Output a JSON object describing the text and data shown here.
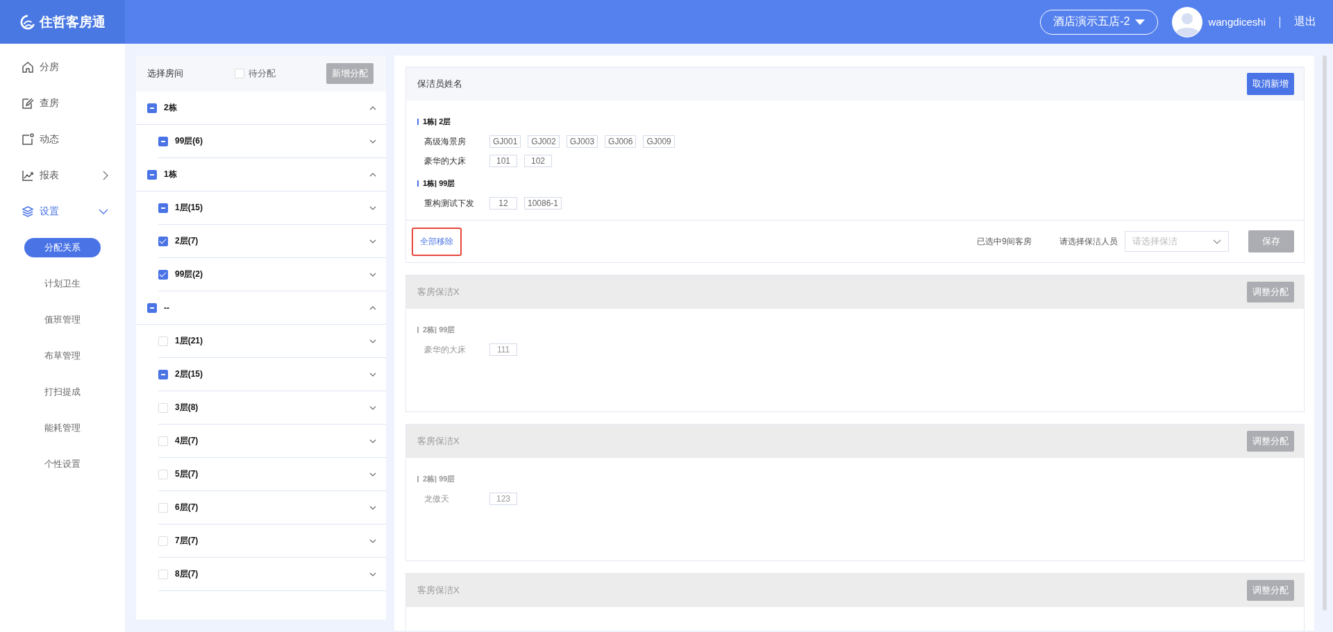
{
  "header": {
    "logo_text": "住哲客房通",
    "store_selector": "酒店演示五店-2",
    "username": "wangdiceshi",
    "logout": "退出"
  },
  "sidebar": {
    "items": [
      {
        "label": "分房",
        "selected": false
      },
      {
        "label": "查房",
        "selected": false
      },
      {
        "label": "动态",
        "selected": false
      },
      {
        "label": "报表",
        "selected": false,
        "expanded": false
      },
      {
        "label": "设置",
        "selected": true,
        "expanded": true,
        "children": [
          {
            "label": "分配关系",
            "selected": true
          },
          {
            "label": "计划卫生",
            "selected": false
          },
          {
            "label": "值班管理",
            "selected": false
          },
          {
            "label": "布草管理",
            "selected": false
          },
          {
            "label": "打扫提成",
            "selected": false
          },
          {
            "label": "能耗管理",
            "selected": false
          },
          {
            "label": "个性设置",
            "selected": false
          }
        ]
      }
    ]
  },
  "room_panel": {
    "title": "选择房间",
    "pending": {
      "label": "待分配",
      "checked": false
    },
    "add_button": {
      "label": "新增分配",
      "disabled": true
    },
    "tree": [
      {
        "label": "2栋",
        "checked": false,
        "indeterminate": true,
        "expanded": true,
        "children": [
          {
            "label": "99层(6)",
            "checked": false,
            "indeterminate": true,
            "expanded": false
          }
        ]
      },
      {
        "label": "1栋",
        "checked": false,
        "indeterminate": true,
        "expanded": true,
        "children": [
          {
            "label": "1层(15)",
            "checked": false,
            "indeterminate": true,
            "expanded": false
          },
          {
            "label": "2层(7)",
            "checked": true,
            "expanded": false
          },
          {
            "label": "99层(2)",
            "checked": true,
            "expanded": false
          }
        ]
      },
      {
        "label": "--",
        "checked": false,
        "indeterminate": true,
        "expanded": true,
        "children": [
          {
            "label": "1层(21)",
            "checked": false,
            "indeterminate": false,
            "expanded": false
          },
          {
            "label": "2层(15)",
            "checked": false,
            "indeterminate": true,
            "expanded": false
          },
          {
            "label": "3层(8)",
            "checked": false,
            "indeterminate": false,
            "expanded": false
          },
          {
            "label": "4层(7)",
            "checked": false,
            "indeterminate": false,
            "expanded": false
          },
          {
            "label": "5层(7)",
            "checked": false,
            "indeterminate": false,
            "expanded": false
          },
          {
            "label": "6层(7)",
            "checked": false,
            "indeterminate": false,
            "expanded": false
          },
          {
            "label": "7层(7)",
            "checked": false,
            "indeterminate": false,
            "expanded": false
          },
          {
            "label": "8层(7)",
            "checked": false,
            "indeterminate": false,
            "expanded": false
          }
        ]
      }
    ]
  },
  "cards": [
    {
      "kind": "editing",
      "title": "保洁员姓名",
      "button": "取消新增",
      "groups": [
        {
          "heading": "1栋| 2层",
          "rows": [
            {
              "room_type": "高级海景房",
              "rooms": [
                "GJ001",
                "GJ002",
                "GJ003",
                "GJ006",
                "GJ009"
              ]
            },
            {
              "room_type": "豪华的大床",
              "rooms": [
                "101",
                "102"
              ]
            }
          ]
        },
        {
          "heading": "1栋| 99层",
          "rows": [
            {
              "room_type": "重构测试下发",
              "rooms": [
                "12",
                "10086-1"
              ]
            }
          ]
        }
      ],
      "footer": {
        "remove_all": {
          "label": "全部移除",
          "highlighted": true
        },
        "selected_count": "已选中9间客房",
        "cleaner_label": "请选择保洁人员",
        "cleaner_select": {
          "placeholder": "请选择保洁"
        },
        "save_button": {
          "label": "保存",
          "disabled": true
        }
      }
    },
    {
      "kind": "assigned",
      "title": "客房保洁X",
      "button": "调整分配",
      "groups": [
        {
          "heading": "2栋| 99层",
          "rows": [
            {
              "room_type": "豪华的大床",
              "rooms": [
                "111"
              ]
            }
          ]
        }
      ]
    },
    {
      "kind": "assigned",
      "title": "客房保洁X",
      "button": "调整分配",
      "groups": [
        {
          "heading": "2栋| 99层",
          "rows": [
            {
              "room_type": "龙傲天",
              "rooms": [
                "123"
              ]
            }
          ]
        }
      ]
    },
    {
      "kind": "assigned",
      "title": "客房保洁X",
      "button": "调整分配"
    }
  ]
}
